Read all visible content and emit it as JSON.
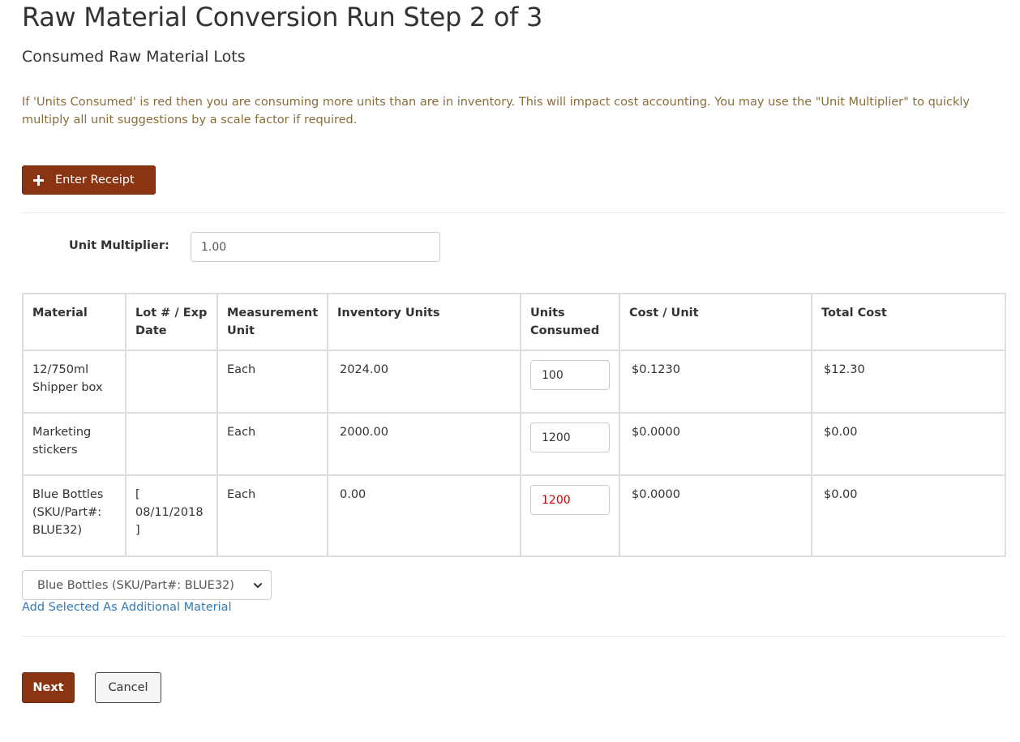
{
  "page": {
    "title": "Raw Material Conversion Run Step 2 of 3",
    "subtitle": "Consumed Raw Material Lots",
    "notice": "If 'Units Consumed' is red then you are consuming more units than are in inventory. This will impact cost accounting. You may use the \"Unit Multiplier\" to quickly multiply all unit suggestions by a scale factor if required."
  },
  "toolbar": {
    "enter_receipt_label": "Enter Receipt",
    "enter_receipt_icon": "plus-icon"
  },
  "multiplier": {
    "label": "Unit Multiplier:",
    "value": "1.00"
  },
  "table": {
    "headers": {
      "material": "Material",
      "lot": "Lot # / Exp Date",
      "measurement": "Measurement Unit",
      "inventory": "Inventory Units",
      "consumed": "Units Consumed",
      "cost_unit": "Cost / Unit",
      "total": "Total Cost"
    },
    "rows": [
      {
        "material": "12/750ml Shipper box",
        "lot": "",
        "measurement": "Each",
        "inventory": "2024.00",
        "consumed": "100",
        "cost_unit": "$0.1230",
        "total": "$12.30"
      },
      {
        "material": "Marketing stickers",
        "lot": "",
        "measurement": "Each",
        "inventory": "2000.00",
        "consumed": "1200",
        "cost_unit": "$0.0000",
        "total": "$0.00"
      },
      {
        "material": "Blue Bottles (SKU/Part#: BLUE32)",
        "lot": "[ 08/11/2018 ]",
        "measurement": "Each",
        "inventory": "0.00",
        "consumed": "1200",
        "cost_unit": "$0.0000",
        "total": "$0.00"
      }
    ]
  },
  "additional": {
    "selected": "Blue Bottles (SKU/Part#: BLUE32)",
    "select_icon": "chevron-down-icon",
    "add_link": "Add Selected As Additional Material"
  },
  "actions": {
    "next": "Next",
    "cancel": "Cancel"
  },
  "colors": {
    "primary_button": "#8b3412",
    "notice_text": "#8a6d3b",
    "link": "#337ab7",
    "over_inventory": "#cc0000"
  }
}
